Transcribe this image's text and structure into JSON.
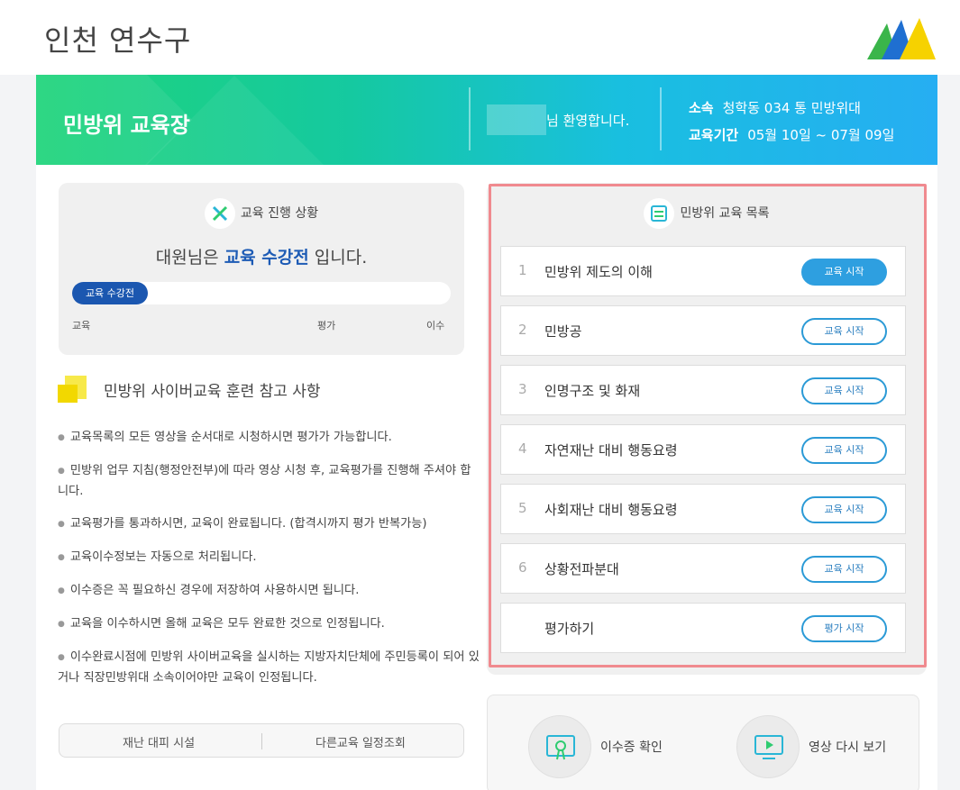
{
  "header": {
    "site_title": "인천 연수구"
  },
  "banner": {
    "title": "민방위 교육장",
    "welcome": "님 환영합니다.",
    "affiliation_label": "소속",
    "affiliation_value": "청학동 034 통 민방위대",
    "period_label": "교육기간",
    "period_value": "05월 10일 ~ 07월 09일"
  },
  "progress": {
    "heading": "교육 진행 상황",
    "status_prefix": "대원님은",
    "status_highlight": "교육 수강전",
    "status_suffix": "입니다.",
    "bar_label": "교육 수강전",
    "bar_fraction": 0.2,
    "steps": [
      "교육",
      "평가",
      "이수"
    ]
  },
  "reference": {
    "title": "민방위 사이버교육 훈련 참고 사항",
    "notes": [
      "교육목록의 모든 영상을 순서대로 시청하시면 평가가 가능합니다.",
      "민방위 업무 지침(행정안전부)에 따라 영상 시청 후, 교육평가를 진행해 주셔야 합니다.",
      "교육평가를 통과하시면, 교육이 완료됩니다. (합격시까지 평가 반복가능)",
      "교육이수정보는 자동으로 처리됩니다.",
      "이수증은 꼭 필요하신 경우에 저장하여 사용하시면 됩니다.",
      "교육을 이수하시면 올해 교육은 모두 완료한 것으로 인정됩니다.",
      "이수완료시점에 민방위 사이버교육을 실시하는 지방자치단체에 주민등록이 되어 있거나 직장민방위대 소속이어야만 교육이 인정됩니다."
    ]
  },
  "links": {
    "shelter": "재난 대피 시설",
    "schedule": "다른교육 일정조회"
  },
  "course_list": {
    "heading": "민방위 교육 목록",
    "items": [
      {
        "num": "1",
        "title": "민방위 제도의 이해",
        "button": "교육 시작",
        "active": true
      },
      {
        "num": "2",
        "title": "민방공",
        "button": "교육 시작",
        "active": false
      },
      {
        "num": "3",
        "title": "인명구조 및 화재",
        "button": "교육 시작",
        "active": false
      },
      {
        "num": "4",
        "title": "자연재난 대비 행동요령",
        "button": "교육 시작",
        "active": false
      },
      {
        "num": "5",
        "title": "사회재난 대비 행동요령",
        "button": "교육 시작",
        "active": false
      },
      {
        "num": "6",
        "title": "상황전파분대",
        "button": "교육 시작",
        "active": false
      },
      {
        "num": "",
        "title": "평가하기",
        "button": "평가 시작",
        "active": false
      }
    ]
  },
  "bottom": {
    "certificate": "이수증 확인",
    "replay": "영상 다시 보기"
  },
  "colors": {
    "accent": "#1d5bb5",
    "button_blue": "#2e9fe0",
    "highlight_frame": "#f08a8f",
    "banner_start": "#1fd47a",
    "banner_end": "#26aef2"
  }
}
